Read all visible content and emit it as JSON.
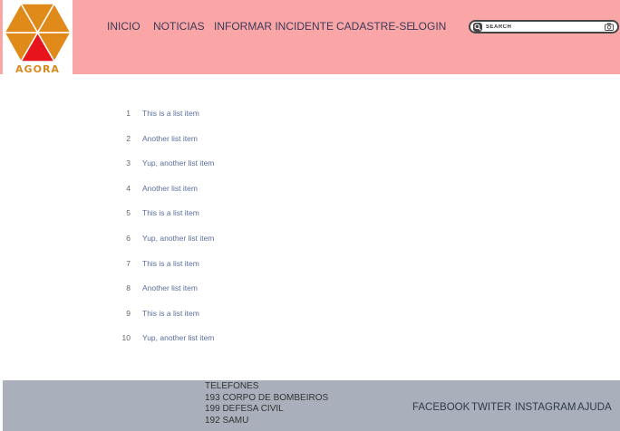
{
  "logo": {
    "text": "AGORA"
  },
  "nav": {
    "items": [
      {
        "label": "INICIO"
      },
      {
        "label": "NOTICIAS"
      },
      {
        "label": "INFORMAR INCIDENTE"
      },
      {
        "label": "CADASTRE-SE"
      },
      {
        "label": "LOGIN"
      }
    ]
  },
  "search": {
    "placeholder": "SEARCH"
  },
  "list": {
    "items": [
      {
        "num": "1",
        "text": "This is a list item"
      },
      {
        "num": "2",
        "text": "Another list item"
      },
      {
        "num": "3",
        "text": "Yup, another list item"
      },
      {
        "num": "4",
        "text": "Another list item"
      },
      {
        "num": "5",
        "text": "This is a list item"
      },
      {
        "num": "6",
        "text": "Yup, another list item"
      },
      {
        "num": "7",
        "text": "This is a list item"
      },
      {
        "num": "8",
        "text": "Another list item"
      },
      {
        "num": "9",
        "text": "This is a list item"
      },
      {
        "num": "10",
        "text": "Yup, another list item"
      }
    ]
  },
  "footer": {
    "phones_title": "TELEFONES",
    "phones": [
      "193 CORPO DE BOMBEIROS",
      "199 DEFESA CIVIL",
      "192 SAMU"
    ],
    "social": [
      {
        "label": "FACEBOOK"
      },
      {
        "label": "TWITER"
      },
      {
        "label": "INSTAGRAM"
      },
      {
        "label": "AJUDA"
      }
    ]
  },
  "colors": {
    "header_bg": "#fba6a6",
    "footer_bg": "#aab0bb",
    "logo_orange": "#e08a1a",
    "logo_red": "#e8141c",
    "list_text": "#5a6f9a"
  },
  "icons": [
    "search-icon",
    "camera-icon"
  ]
}
